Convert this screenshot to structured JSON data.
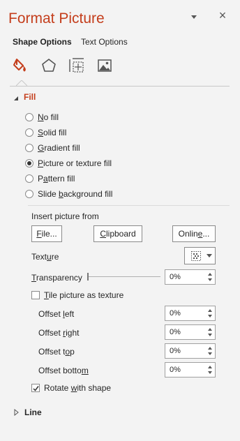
{
  "pane": {
    "title": "Format Picture"
  },
  "tabs": [
    {
      "label": "Shape Options",
      "active": true
    },
    {
      "label": "Text Options",
      "active": false
    }
  ],
  "icons": [
    "fill-line-icon",
    "effects-icon",
    "size-properties-icon",
    "picture-icon"
  ],
  "fill": {
    "section_title": "Fill",
    "options": [
      {
        "pre": "",
        "acc": "N",
        "post": "o fill",
        "selected": false
      },
      {
        "pre": "",
        "acc": "S",
        "post": "olid fill",
        "selected": false
      },
      {
        "pre": "",
        "acc": "G",
        "post": "radient fill",
        "selected": false
      },
      {
        "pre": "",
        "acc": "P",
        "post": "icture or texture fill",
        "selected": true
      },
      {
        "pre": "P",
        "acc": "a",
        "post": "ttern fill",
        "selected": false
      },
      {
        "pre": "Slide ",
        "acc": "b",
        "post": "ackground fill",
        "selected": false
      }
    ],
    "insert_from": "Insert picture from",
    "buttons": {
      "file": {
        "pre": "",
        "acc": "F",
        "post": "ile..."
      },
      "clipboard": {
        "pre": "",
        "acc": "C",
        "post": "lipboard"
      },
      "online": {
        "pre": "Onlin",
        "acc": "e",
        "post": "..."
      }
    },
    "texture": {
      "pre": "Text",
      "acc": "u",
      "post": "re"
    },
    "transparency": {
      "pre": "",
      "acc": "T",
      "post": "ransparency",
      "value": "0%",
      "level": 0
    },
    "tile": {
      "pre": "",
      "acc": "T",
      "post": "ile picture as texture",
      "checked": false
    },
    "offsets": [
      {
        "pre": "Offset ",
        "acc": "l",
        "post": "eft",
        "value": "0%"
      },
      {
        "pre": "Offset ",
        "acc": "r",
        "post": "ight",
        "value": "0%"
      },
      {
        "pre": "Offset t",
        "acc": "o",
        "post": "p",
        "value": "0%"
      },
      {
        "pre": "Offset botto",
        "acc": "m",
        "post": "",
        "value": "0%"
      }
    ],
    "rotate": {
      "pre": "Rotate ",
      "acc": "w",
      "post": "ith shape",
      "checked": true
    }
  },
  "line": {
    "section_title": "Line"
  },
  "colors": {
    "accent": "#c43e1c",
    "background": "#f3f3f3"
  }
}
